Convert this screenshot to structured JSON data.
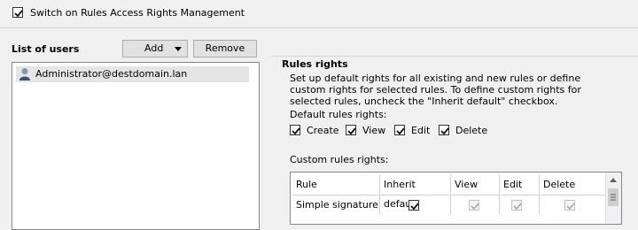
{
  "toggle": {
    "label": "Switch on Rules Access Rights Management",
    "checked": true
  },
  "users": {
    "title": "List of users",
    "add_label": "Add",
    "remove_label": "Remove",
    "items": [
      {
        "name": "Administrator@destdomain.lan"
      }
    ]
  },
  "rules_rights": {
    "title": "Rules rights",
    "description": "Set up default rights for all existing and new rules or define custom rights for selected rules. To define custom rights for selected rules, uncheck the \"Inherit default\" checkbox.",
    "default_label": "Default rules rights:",
    "defaults": [
      {
        "label": "Create",
        "checked": true
      },
      {
        "label": "View",
        "checked": true
      },
      {
        "label": "Edit",
        "checked": true
      },
      {
        "label": "Delete",
        "checked": true
      }
    ],
    "custom_label": "Custom rules rights:",
    "columns": [
      "Rule",
      "Inherit default",
      "View",
      "Edit",
      "Delete"
    ],
    "rows": [
      {
        "rule": "Simple signature bc",
        "inherit_default": true,
        "view": true,
        "edit": true,
        "delete": true
      }
    ]
  }
}
